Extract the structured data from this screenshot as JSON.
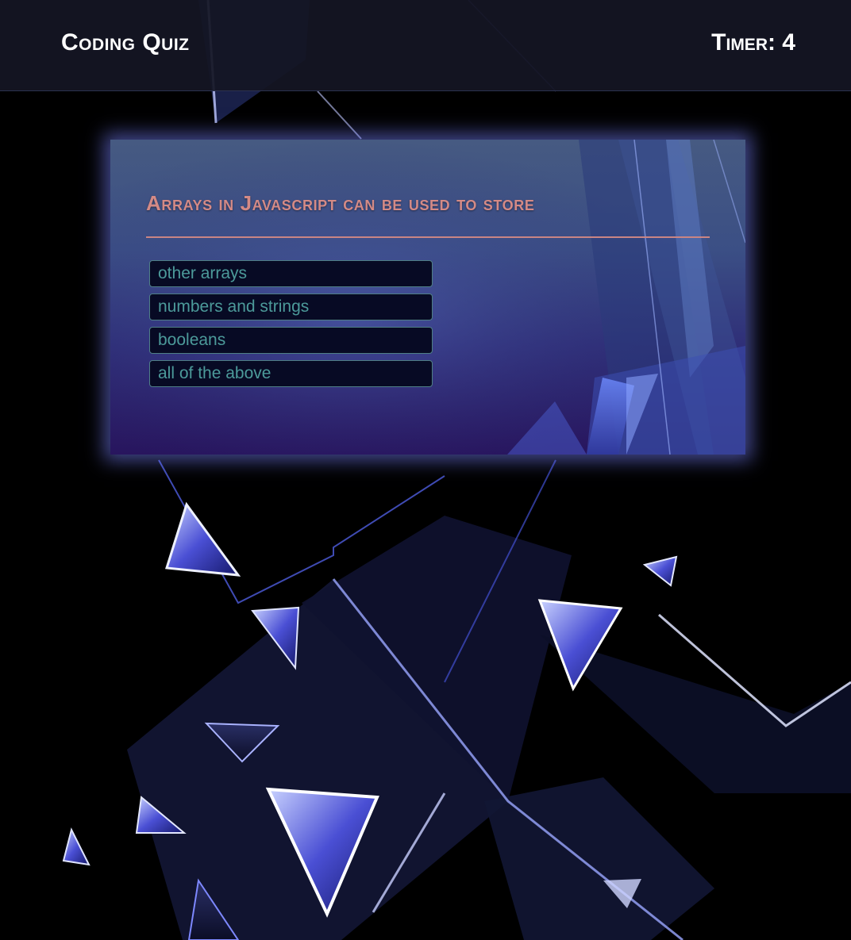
{
  "header": {
    "title": "Coding Quiz",
    "timer_label": "Timer: 4"
  },
  "quiz": {
    "question": "Arrays in Javascript can be used to store",
    "answers": [
      "other arrays",
      "numbers and strings",
      "booleans",
      "all of the above"
    ]
  },
  "theme": {
    "header_bg": "#141624",
    "question_color": "#d48a86",
    "answer_text_color": "#4c9a9a",
    "answer_bg": "#070a24",
    "card_glow": "#7882ff"
  }
}
